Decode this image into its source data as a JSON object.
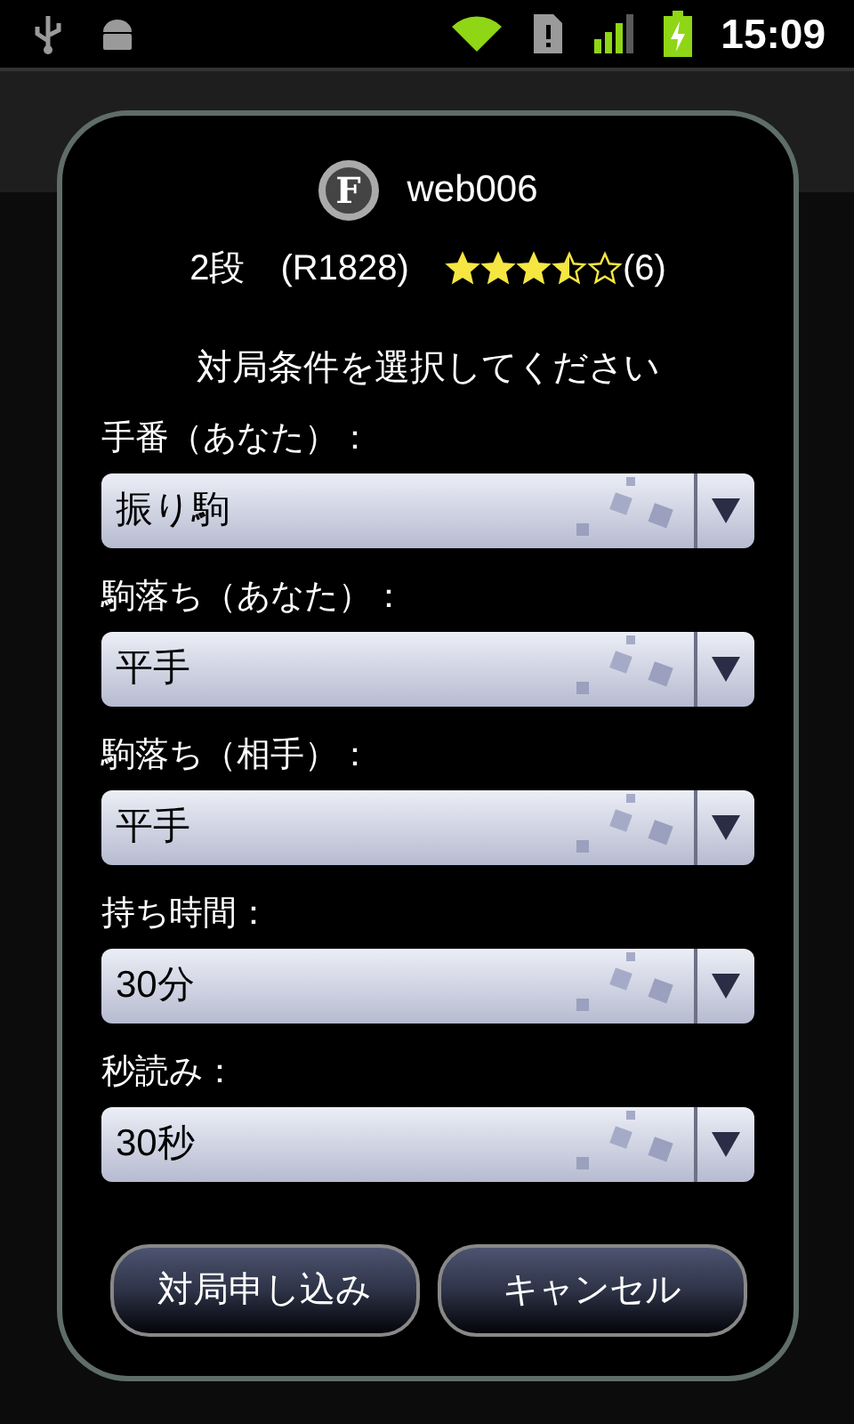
{
  "status_bar": {
    "time": "15:09"
  },
  "dialog": {
    "badge": "F",
    "username": "web006",
    "rank": "2段",
    "rating": "(R1828)",
    "stars": 3.5,
    "review_count": "(6)",
    "prompt": "対局条件を選択してください",
    "fields": [
      {
        "label": "手番（あなた）：",
        "value": "振り駒"
      },
      {
        "label": "駒落ち（あなた）：",
        "value": "平手"
      },
      {
        "label": "駒落ち（相手）：",
        "value": "平手"
      },
      {
        "label": "持ち時間：",
        "value": "30分"
      },
      {
        "label": "秒読み：",
        "value": "30秒"
      }
    ],
    "buttons": [
      "対局申し込み",
      "キャンセル"
    ]
  }
}
